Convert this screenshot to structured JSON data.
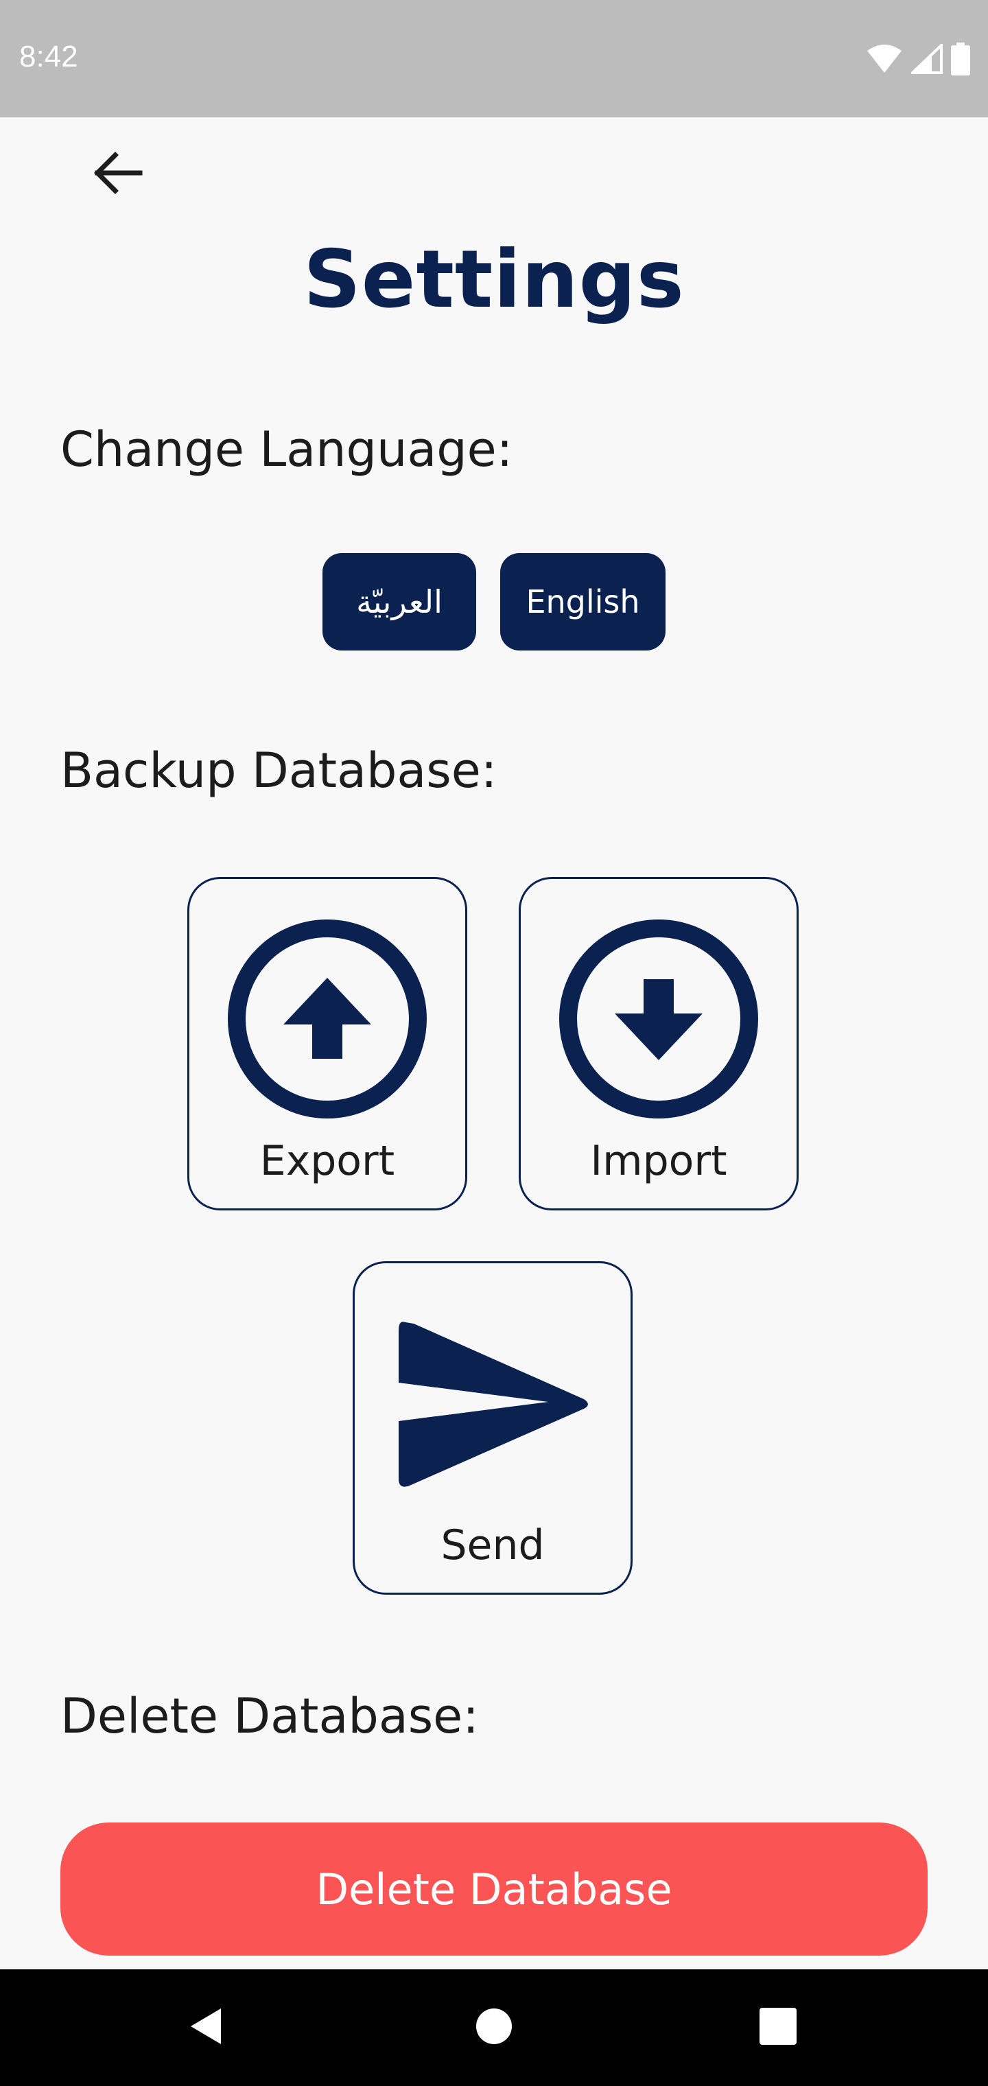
{
  "status_bar": {
    "time": "8:42",
    "icons": [
      "wifi-icon",
      "signal-icon",
      "battery-icon"
    ]
  },
  "header": {
    "back_icon": "arrow-left-icon",
    "title": "Settings"
  },
  "language": {
    "label": "Change Language:",
    "options": [
      "العربيّة",
      "English"
    ]
  },
  "backup": {
    "label": "Backup Database:",
    "export_label": "Export",
    "import_label": "Import",
    "send_label": "Send"
  },
  "delete": {
    "label": "Delete Database:",
    "button_label": "Delete Database"
  },
  "nav": {
    "icons": [
      "back-triangle-icon",
      "home-circle-icon",
      "recents-square-icon"
    ]
  },
  "colors": {
    "primary": "#0b2150",
    "danger": "#fb5455",
    "background": "#f8f8f9",
    "status_bar": "#bcbcbc"
  }
}
